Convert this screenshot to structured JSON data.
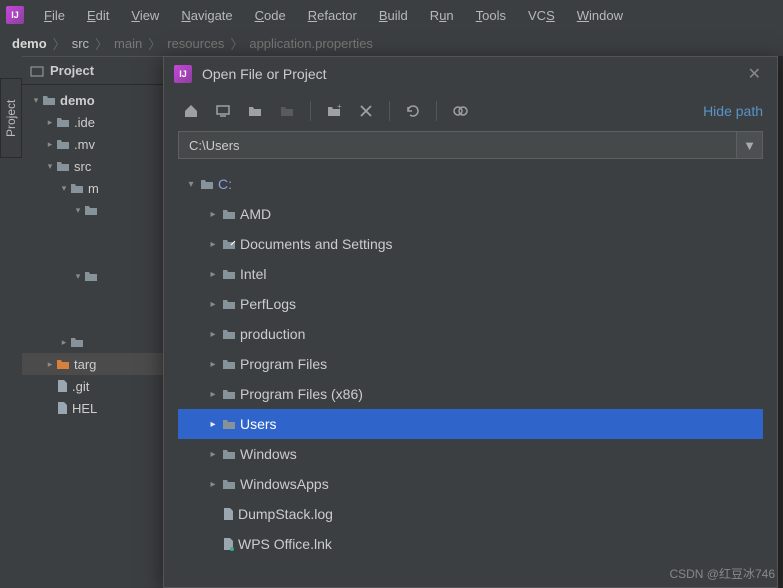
{
  "menu": {
    "items": [
      "File",
      "Edit",
      "View",
      "Navigate",
      "Code",
      "Refactor",
      "Build",
      "Run",
      "Tools",
      "VCS",
      "Window"
    ]
  },
  "breadcrumb": {
    "root": "demo",
    "parts": [
      "src",
      "main",
      "resources",
      "application.properties"
    ]
  },
  "sidebar_tab": "Project",
  "project_panel": {
    "title": "Project",
    "tree": [
      {
        "depth": 0,
        "exp": "▾",
        "icon": "folder",
        "label": "demo",
        "bold": true
      },
      {
        "depth": 1,
        "exp": "▸",
        "icon": "folder",
        "label": ".ide"
      },
      {
        "depth": 1,
        "exp": "▸",
        "icon": "folder",
        "label": ".mv"
      },
      {
        "depth": 1,
        "exp": "▾",
        "icon": "folder",
        "label": "src"
      },
      {
        "depth": 2,
        "exp": "▾",
        "icon": "folder",
        "label": "m"
      },
      {
        "depth": 3,
        "exp": "▾",
        "icon": "folder",
        "label": ""
      },
      {
        "depth": 4,
        "exp": "",
        "icon": "",
        "label": ""
      },
      {
        "depth": 4,
        "exp": "",
        "icon": "",
        "label": ""
      },
      {
        "depth": 3,
        "exp": "▾",
        "icon": "folder",
        "label": ""
      },
      {
        "depth": 4,
        "exp": "",
        "icon": "",
        "label": ""
      },
      {
        "depth": 4,
        "exp": "",
        "icon": "",
        "label": ""
      },
      {
        "depth": 2,
        "exp": "▸",
        "icon": "folder",
        "label": ""
      },
      {
        "depth": 1,
        "exp": "▸",
        "icon": "folder-orange",
        "label": "targ",
        "selected": true
      },
      {
        "depth": 1,
        "exp": "",
        "icon": "file",
        "label": ".git"
      },
      {
        "depth": 1,
        "exp": "",
        "icon": "file",
        "label": "HEL"
      }
    ]
  },
  "dialog": {
    "title": "Open File or Project",
    "hide_path": "Hide path",
    "path": "C:\\Users",
    "tree": [
      {
        "depth": 0,
        "exp": "▾",
        "icon": "folder",
        "label": "C:",
        "drive": true
      },
      {
        "depth": 1,
        "exp": "▸",
        "icon": "folder",
        "label": "AMD"
      },
      {
        "depth": 1,
        "exp": "▸",
        "icon": "folder-link",
        "label": "Documents and Settings"
      },
      {
        "depth": 1,
        "exp": "▸",
        "icon": "folder",
        "label": "Intel"
      },
      {
        "depth": 1,
        "exp": "▸",
        "icon": "folder",
        "label": "PerfLogs"
      },
      {
        "depth": 1,
        "exp": "▸",
        "icon": "folder",
        "label": "production"
      },
      {
        "depth": 1,
        "exp": "▸",
        "icon": "folder",
        "label": "Program Files"
      },
      {
        "depth": 1,
        "exp": "▸",
        "icon": "folder",
        "label": "Program Files (x86)"
      },
      {
        "depth": 1,
        "exp": "▸",
        "icon": "folder",
        "label": "Users",
        "selected": true
      },
      {
        "depth": 1,
        "exp": "▸",
        "icon": "folder",
        "label": "Windows"
      },
      {
        "depth": 1,
        "exp": "▸",
        "icon": "folder",
        "label": "WindowsApps"
      },
      {
        "depth": 1,
        "exp": "",
        "icon": "file",
        "label": "DumpStack.log"
      },
      {
        "depth": 1,
        "exp": "",
        "icon": "file-link",
        "label": "WPS Office.lnk"
      }
    ]
  },
  "watermark": "CSDN @红豆冰746"
}
